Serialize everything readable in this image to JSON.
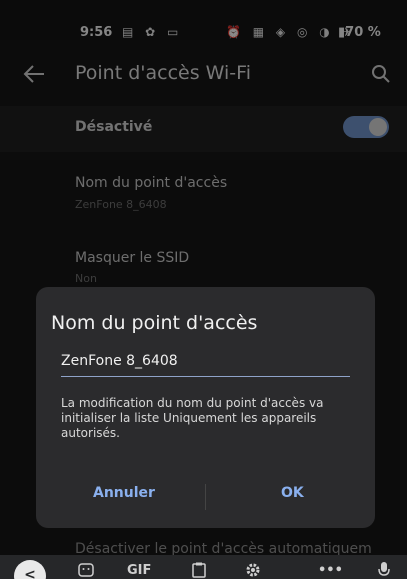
{
  "status_bar": {
    "time": "9:56",
    "left_icons": "▤ ✿ ▭",
    "right_icons": "⏰ ▦ ◈ ◎ ◑ ✈",
    "battery": "▮70 %"
  },
  "app_bar": {
    "title": "Point d'accès Wi-Fi"
  },
  "hotspot": {
    "toggle_label": "Désactivé",
    "toggle_on": true,
    "accent_color": "#6f92c9"
  },
  "settings": {
    "items": [
      {
        "title": "Nom du point d'accès",
        "subtitle": "ZenFone 8_6408"
      },
      {
        "title": "Masquer le SSID",
        "subtitle": "Non"
      }
    ],
    "peek_item": "Désactiver le point d'accès automatiquem"
  },
  "dialog": {
    "title": "Nom du point d'accès",
    "input_value": "ZenFone 8_6408",
    "message": "La modification du nom du point d'accès va initialiser la liste Uniquement les appareils autorisés.",
    "cancel_label": "Annuler",
    "ok_label": "OK"
  },
  "keyboard": {
    "back": "<",
    "gif": "GIF",
    "more": "•••"
  }
}
